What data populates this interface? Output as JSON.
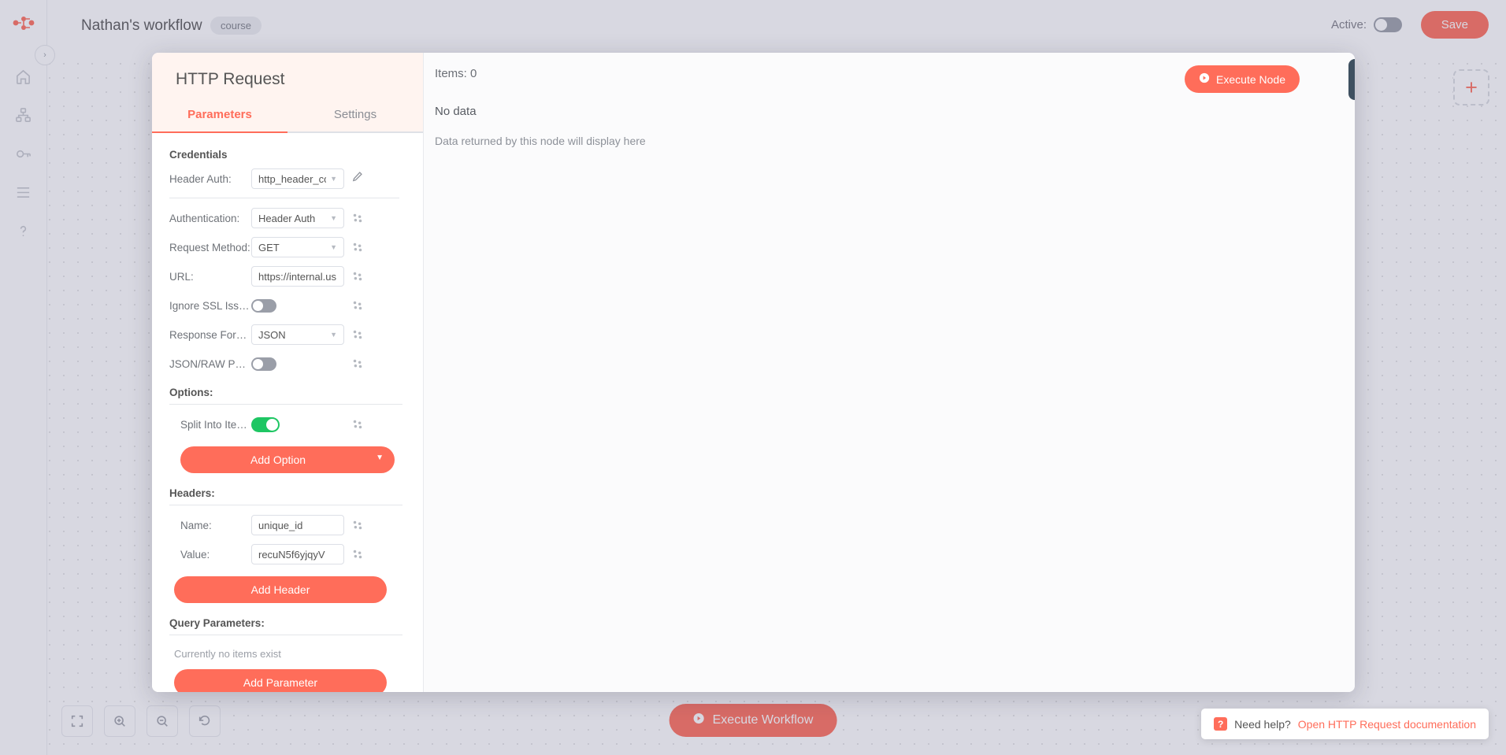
{
  "topbar": {
    "workflow_name": "Nathan's workflow",
    "tag": "course",
    "active_label": "Active:",
    "active_on": false,
    "save_label": "Save"
  },
  "rail": {
    "icons": [
      "logo-icon",
      "home-icon",
      "workflows-icon",
      "credentials-icon",
      "executions-icon",
      "help-icon"
    ],
    "expand_label": "›"
  },
  "canvas": {
    "add_node_label": "+",
    "zoom_buttons": [
      "fit-view-icon",
      "zoom-in-icon",
      "zoom-out-icon",
      "reset-zoom-icon"
    ],
    "execute_workflow_label": "Execute Workflow"
  },
  "ndv": {
    "node_title": "HTTP Request",
    "tabs": [
      {
        "label": "Parameters",
        "active": true
      },
      {
        "label": "Settings",
        "active": false
      }
    ],
    "credentials": {
      "section_label": "Credentials",
      "header_auth_label": "Header Auth:",
      "header_auth_value": "http_header_cour"
    },
    "parameters": [
      {
        "label": "Authentication:",
        "value": "Header Auth",
        "type": "select"
      },
      {
        "label": "Request Method:",
        "value": "GET",
        "type": "select"
      },
      {
        "label": "URL:",
        "value": "https://internal.us",
        "type": "text"
      },
      {
        "label": "Ignore SSL Issues:",
        "value": false,
        "type": "toggle"
      },
      {
        "label": "Response Format:",
        "value": "JSON",
        "type": "select"
      },
      {
        "label": "JSON/RAW Parame…",
        "value": false,
        "type": "toggle"
      }
    ],
    "options": {
      "section_label": "Options:",
      "items": [
        {
          "label": "Split Into Items:",
          "value": true,
          "type": "toggle"
        }
      ],
      "add_label": "Add Option"
    },
    "headers": {
      "section_label": "Headers:",
      "fields": [
        {
          "label": "Name:",
          "value": "unique_id"
        },
        {
          "label": "Value:",
          "value": "recuN5f6yjqyV"
        }
      ],
      "add_label": "Add Header"
    },
    "query_parameters": {
      "section_label": "Query Parameters:",
      "empty_text": "Currently no items exist",
      "add_label": "Add Parameter"
    },
    "output": {
      "items_label": "Items: 0",
      "no_data": "No data",
      "hint": "Data returned by this node will display here",
      "execute_label": "Execute Node"
    }
  },
  "help": {
    "badge": "?",
    "text": "Need help?",
    "link": "Open HTTP Request documentation"
  },
  "colors": {
    "accent": "#ff6d5a",
    "toggle_on": "#1ec663",
    "toggle_off": "#9a9ea8",
    "close_bg": "#3e5060"
  }
}
